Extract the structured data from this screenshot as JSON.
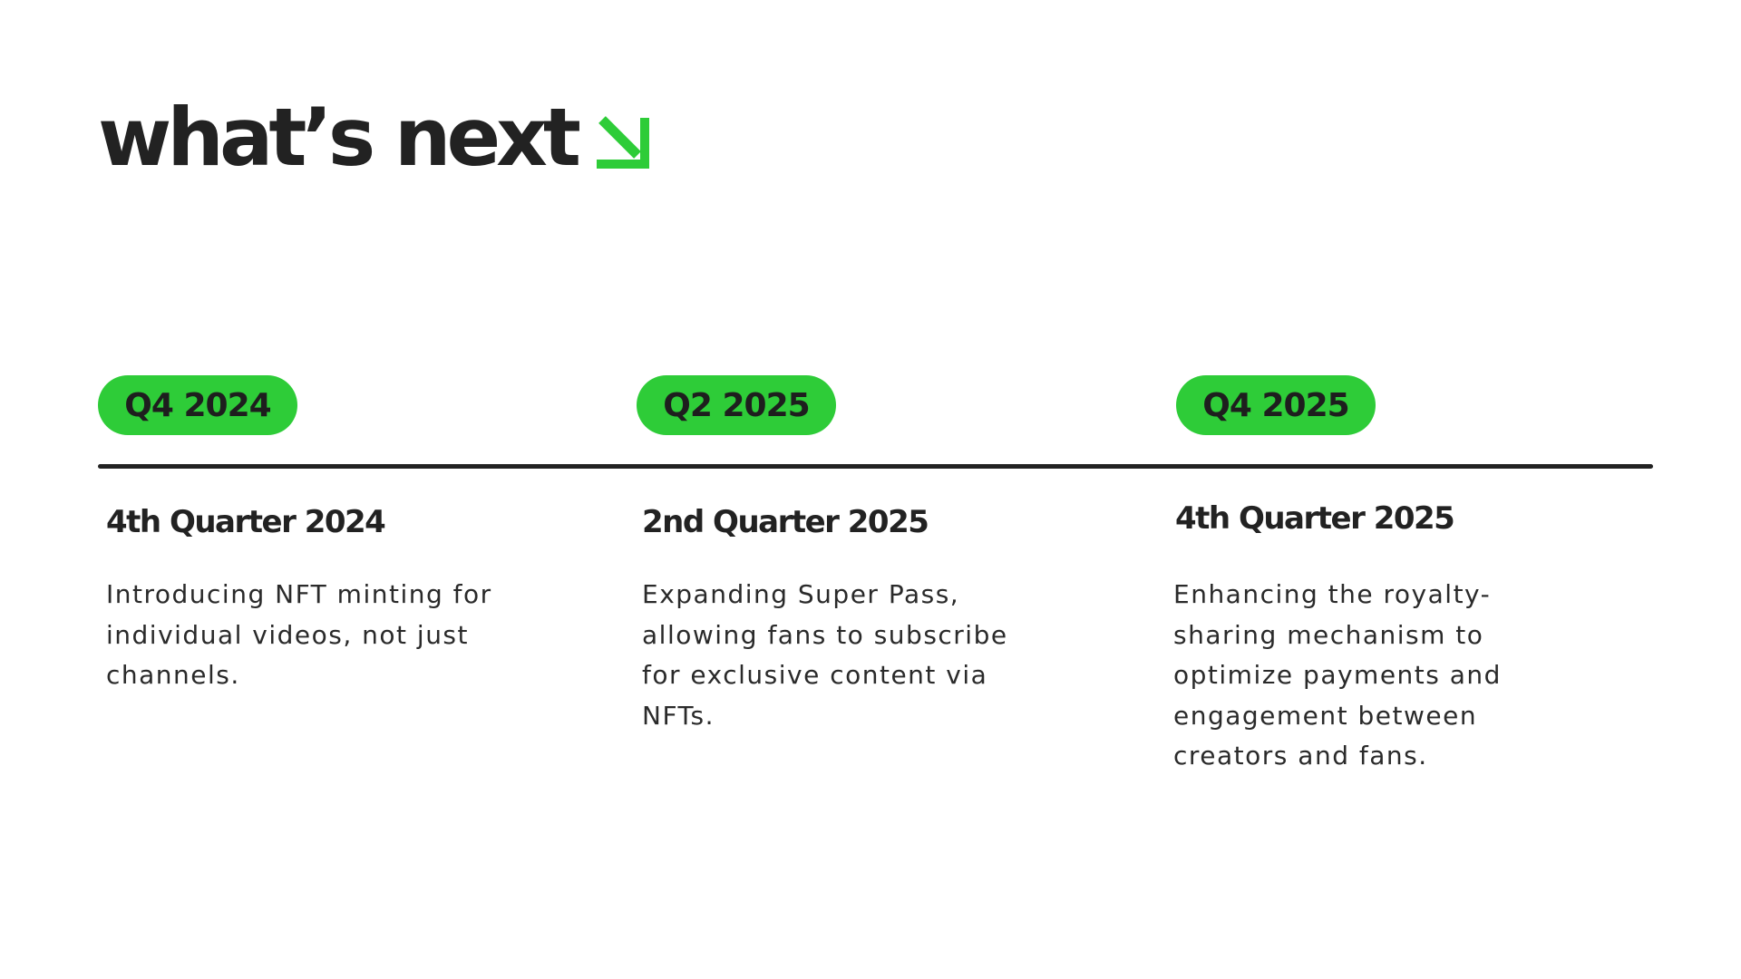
{
  "title": "what’s next",
  "title_icon": "arrow-down-right-icon",
  "accent_color": "#2ecc38",
  "text_color": "#222222",
  "milestones": [
    {
      "badge": "Q4 2024",
      "heading": "4th Quarter 2024",
      "description": "Introducing NFT minting for individual videos, not just channels."
    },
    {
      "badge": "Q2 2025",
      "heading": "2nd Quarter 2025",
      "description": "Expanding Super Pass, allowing fans to subscribe for exclusive content via NFTs."
    },
    {
      "badge": "Q4 2025",
      "heading": "4th Quarter 2025",
      "description": "Enhancing the royalty-sharing mechanism to optimize payments and engagement between creators and fans."
    }
  ]
}
